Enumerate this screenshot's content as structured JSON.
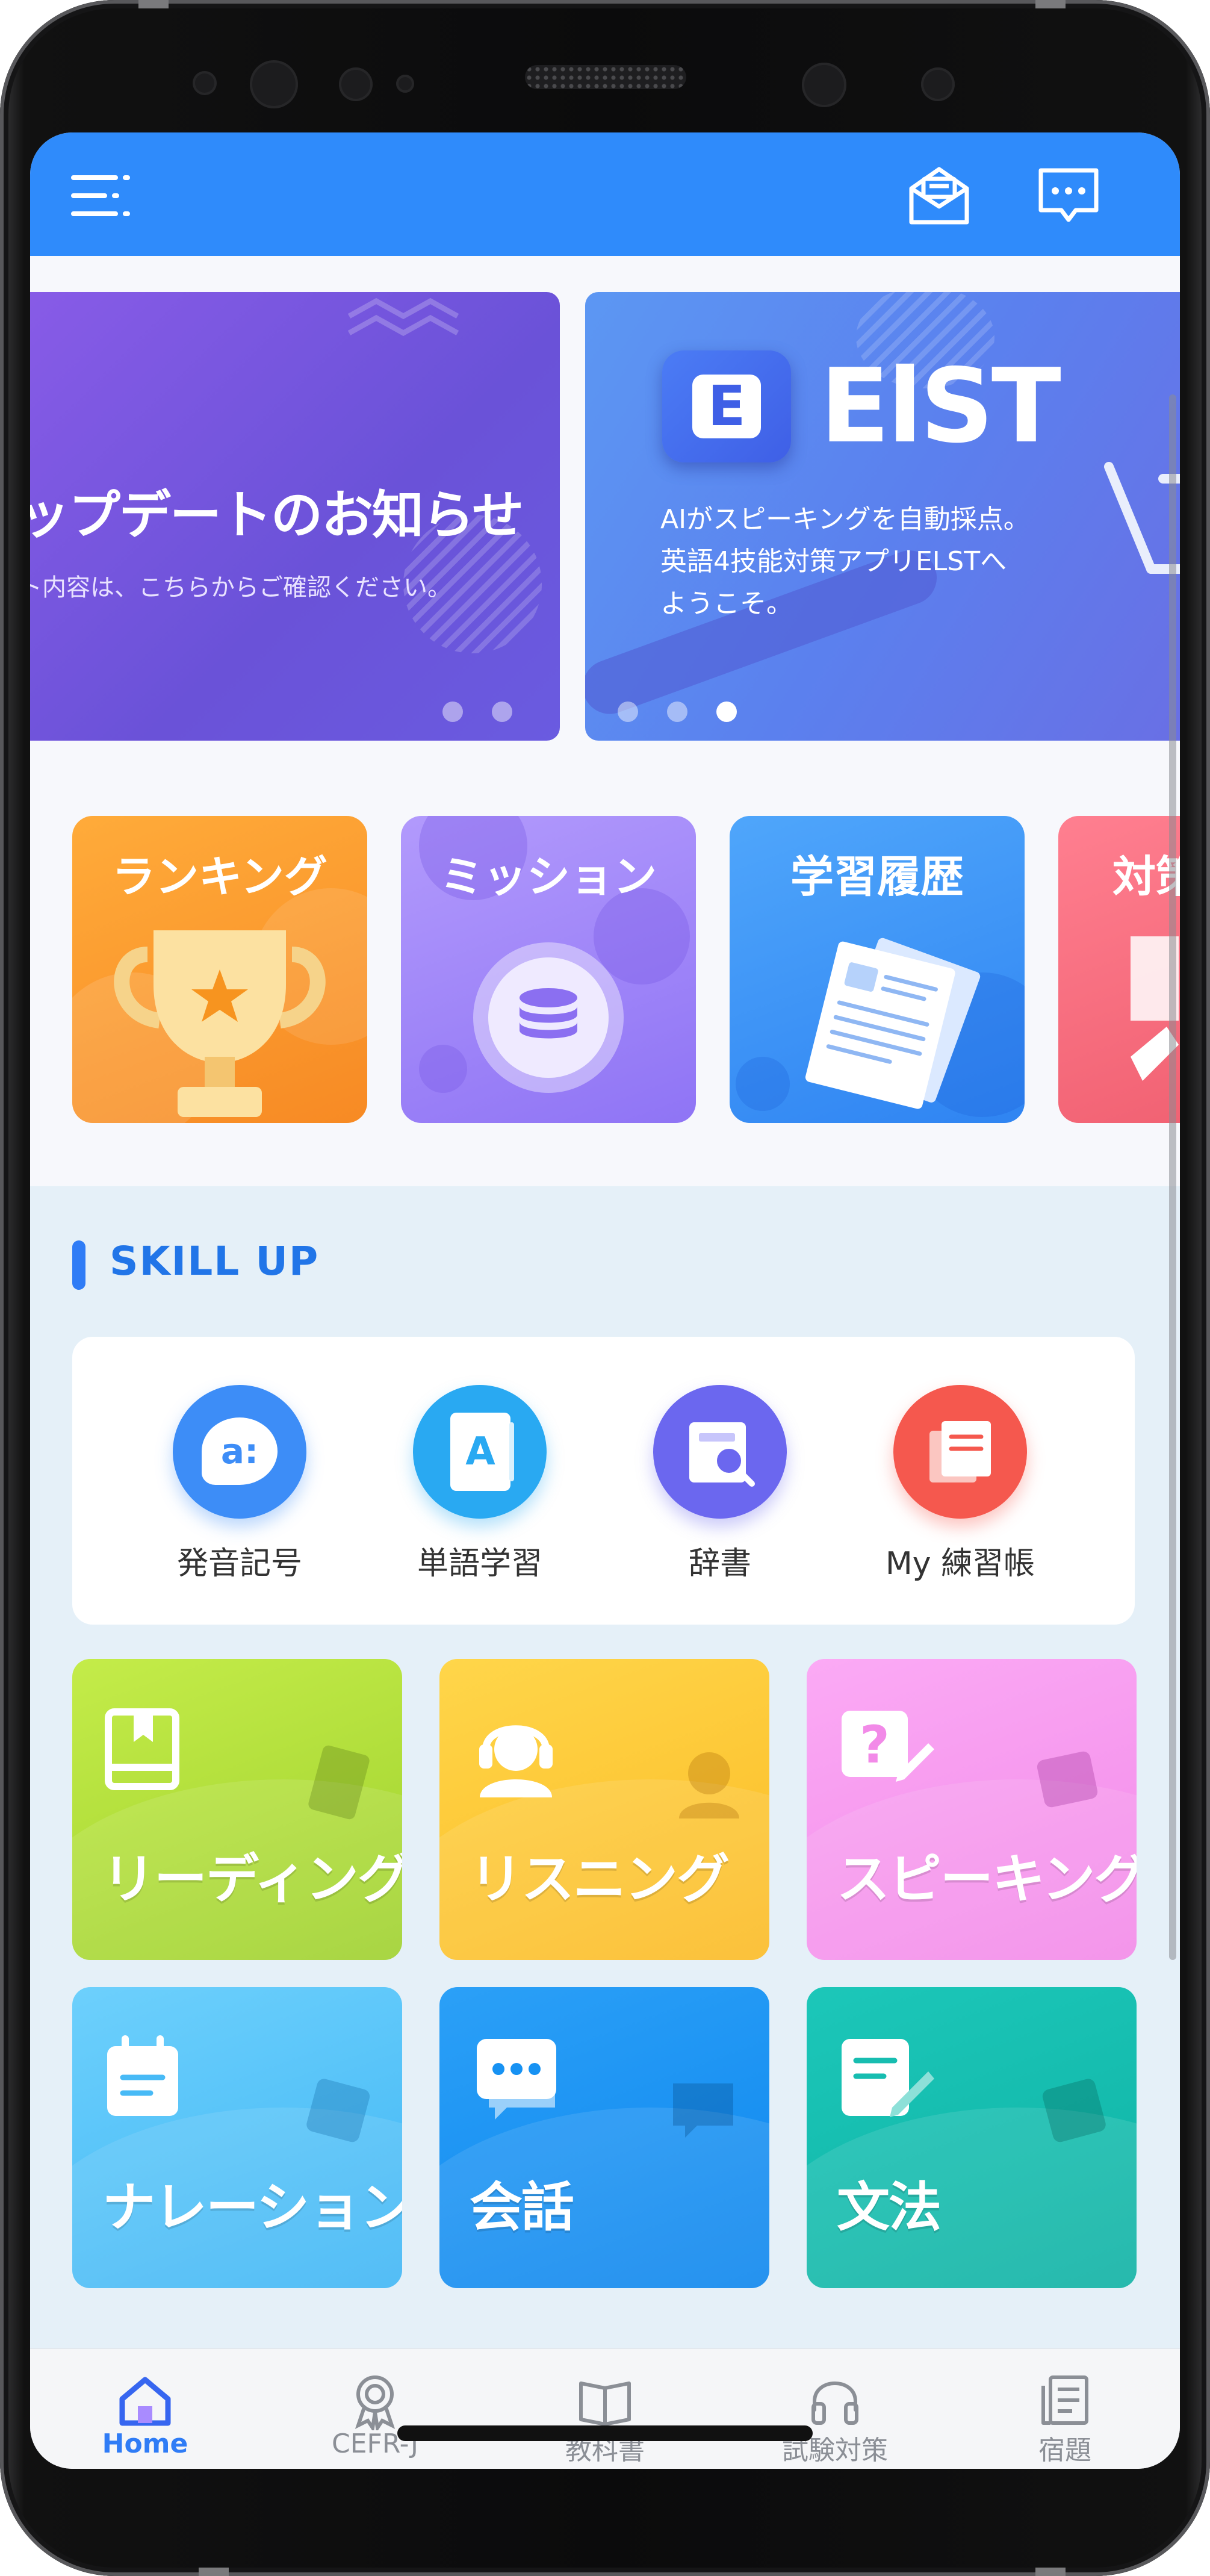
{
  "banners": [
    {
      "title": "ップデートのお知らせ",
      "subtitle": "ト内容は、こちらからご確認ください。"
    },
    {
      "logo_letter": "E",
      "logo_word": "ElST",
      "lines": [
        "AIがスピーキングを自動採点。",
        "英語4技能対策アプリELSTへ",
        "ようこそ。"
      ]
    }
  ],
  "features": [
    {
      "label": "ランキング",
      "color": "#fa9a2b",
      "icon": "trophy-icon"
    },
    {
      "label": "ミッション",
      "color": "#a58afc",
      "icon": "coin-stack-icon"
    },
    {
      "label": "学習履歴",
      "color": "#3d9cf8",
      "icon": "document-icon"
    },
    {
      "label": "対策",
      "color": "#f26e7e",
      "icon": "partial-icon"
    }
  ],
  "skill": {
    "title": "SKILL UP",
    "tools": [
      {
        "label": "発音記号",
        "icon": "phonetic-icon",
        "color": "#3d8df7"
      },
      {
        "label": "単語学習",
        "icon": "word-book-icon",
        "color": "#29a9f2"
      },
      {
        "label": "辞書",
        "icon": "dictionary-icon",
        "color": "#6b67ef"
      },
      {
        "label": "My 練習帳",
        "icon": "notebook-icon",
        "color": "#f5584e"
      }
    ],
    "categories": [
      {
        "label": "リーディング",
        "icon": "book-icon",
        "color": "#b2df3c"
      },
      {
        "label": "リスニング",
        "icon": "headset-icon",
        "color": "#fdc83a"
      },
      {
        "label": "スピーキング",
        "icon": "speech-question-icon",
        "color": "#f79bef"
      },
      {
        "label": "ナレーション",
        "icon": "calendar-note-icon",
        "color": "#58c6fa"
      },
      {
        "label": "会話",
        "icon": "chat-bubble-icon",
        "color": "#1792f3"
      },
      {
        "label": "文法",
        "icon": "edit-doc-icon",
        "color": "#17bdb0"
      }
    ]
  },
  "nav": [
    {
      "label": "Home",
      "icon": "home-icon",
      "active": true
    },
    {
      "label": "CEFR-J",
      "icon": "award-icon"
    },
    {
      "label": "教科書",
      "icon": "open-book-icon"
    },
    {
      "label": "試験対策",
      "icon": "headphones-icon"
    },
    {
      "label": "宿題",
      "icon": "homework-icon"
    }
  ],
  "colors": {
    "appbar": "#2f8bfb",
    "accent": "#2f7cf6"
  }
}
